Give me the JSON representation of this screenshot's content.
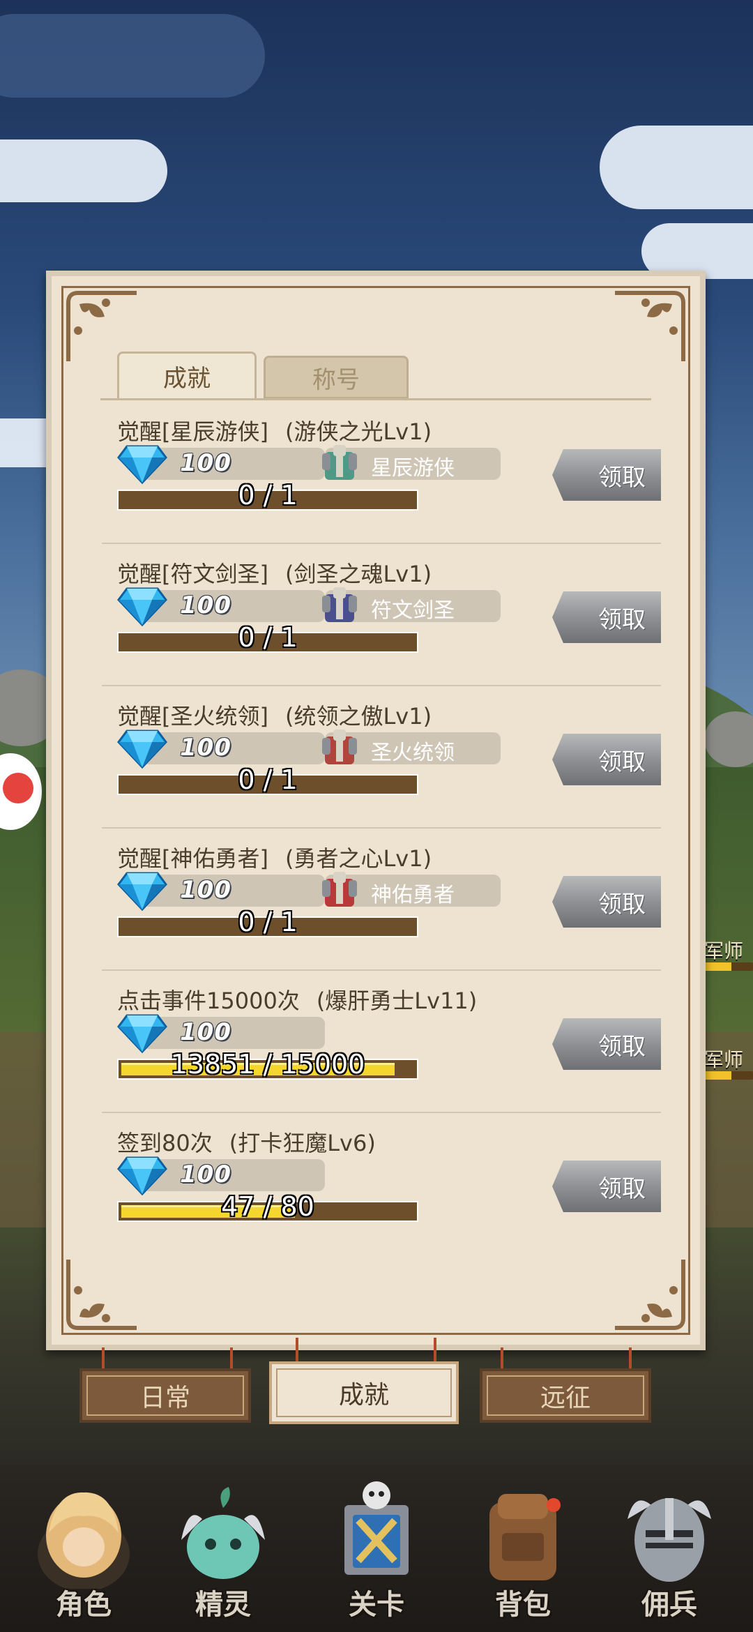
{
  "tabs": [
    {
      "label": "成就",
      "active": true
    },
    {
      "label": "称号",
      "active": false
    }
  ],
  "achievements": [
    {
      "title": "觉醒[星辰游侠]",
      "reward_title": "(游侠之光Lv1)",
      "gem_amount": "100",
      "skin_name": "星辰游侠",
      "skin_icon": "armor-icon",
      "skin_color": "#4f9a86",
      "progress_text": "0 / 1",
      "progress": 0,
      "claim_label": "领取"
    },
    {
      "title": "觉醒[符文剑圣]",
      "reward_title": "(剑圣之魂Lv1)",
      "gem_amount": "100",
      "skin_name": "符文剑圣",
      "skin_icon": "armor-icon",
      "skin_color": "#4a4f8f",
      "progress_text": "0 / 1",
      "progress": 0,
      "claim_label": "领取"
    },
    {
      "title": "觉醒[圣火统领]",
      "reward_title": "(统领之傲Lv1)",
      "gem_amount": "100",
      "skin_name": "圣火统领",
      "skin_icon": "armor-icon",
      "skin_color": "#b0453e",
      "progress_text": "0 / 1",
      "progress": 0,
      "claim_label": "领取"
    },
    {
      "title": "觉醒[神佑勇者]",
      "reward_title": "(勇者之心Lv1)",
      "gem_amount": "100",
      "skin_name": "神佑勇者",
      "skin_icon": "armor-icon",
      "skin_color": "#b8393a",
      "progress_text": "0 / 1",
      "progress": 0,
      "claim_label": "领取"
    },
    {
      "title": "点击事件15000次",
      "reward_title": "(爆肝勇士Lv11)",
      "gem_amount": "100",
      "skin_name": "",
      "progress_text": "13851 / 15000",
      "progress": 0.9234,
      "claim_label": "领取"
    },
    {
      "title": "签到80次",
      "reward_title": "(打卡狂魔Lv6)",
      "gem_amount": "100",
      "skin_name": "",
      "progress_text": "47 / 80",
      "progress": 0.5875,
      "claim_label": "领取"
    }
  ],
  "bottom_tabs": [
    {
      "label": "日常",
      "active": false
    },
    {
      "label": "成就",
      "active": true
    },
    {
      "label": "远征",
      "active": false
    }
  ],
  "background_labels": [
    "军师",
    "军师"
  ],
  "nav": [
    {
      "label": "角色",
      "icon": "hero-icon"
    },
    {
      "label": "精灵",
      "icon": "spirit-icon"
    },
    {
      "label": "关卡",
      "icon": "stage-icon"
    },
    {
      "label": "背包",
      "icon": "backpack-icon"
    },
    {
      "label": "佣兵",
      "icon": "mercenary-icon"
    }
  ],
  "colors": {
    "parchment": "#ede3d0",
    "progress_fill": "#f5d62d",
    "progress_track": "#6e4f2c",
    "claim_button": "#8f9194",
    "gem": "#31b6f0"
  }
}
